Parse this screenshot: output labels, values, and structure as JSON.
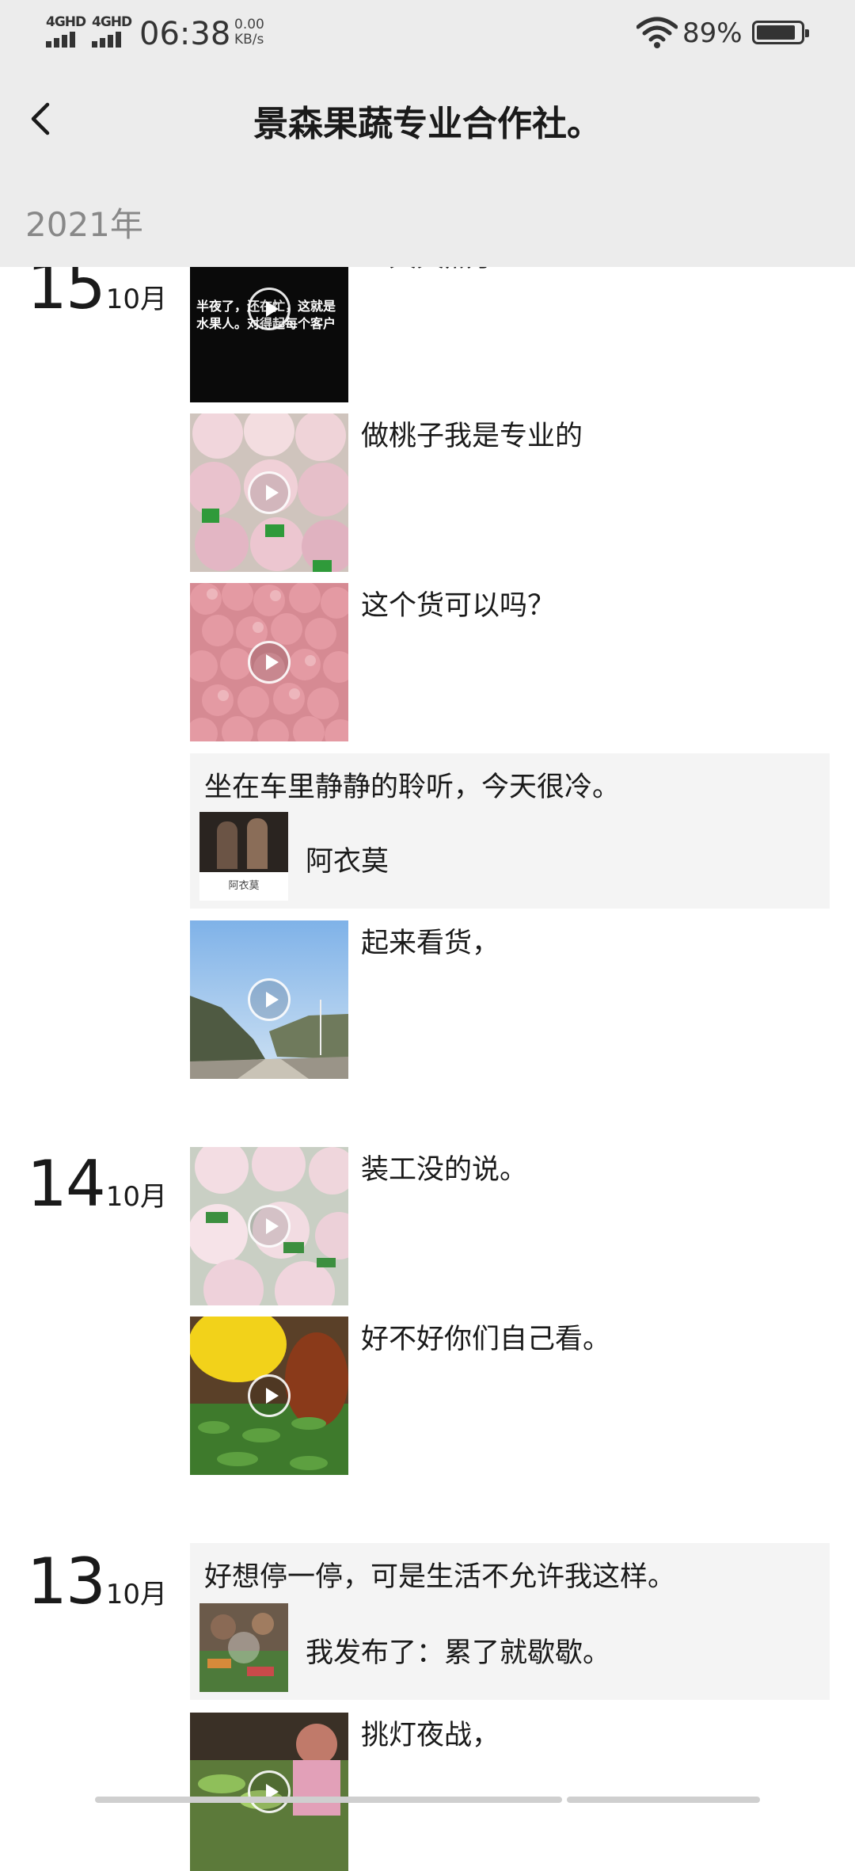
{
  "status_bar": {
    "network_1": "4GHD",
    "network_2": "4GHD",
    "time": "06:38",
    "speed_value": "0.00",
    "speed_unit": "KB/s",
    "battery_percent": "89%",
    "battery_level": 0.89
  },
  "header": {
    "title": "景森果蔬专业合作社。",
    "back_icon": "chevron-left-icon",
    "year": "2021年"
  },
  "days": [
    {
      "day": "15",
      "month": "10月",
      "posts": [
        {
          "type": "video",
          "caption": "…天天黑了",
          "overlay_text": "半夜了，还在忙，这就是水果人。对得起每个客户"
        },
        {
          "type": "video",
          "caption": "做桃子我是专业的"
        },
        {
          "type": "video",
          "caption": "这个货可以吗？"
        },
        {
          "type": "share",
          "text": "坐在车里静静的聆听，今天很冷。",
          "label": "阿衣莫",
          "thumb_text": "阿衣莫"
        },
        {
          "type": "video",
          "caption": "起来看货，"
        }
      ]
    },
    {
      "day": "14",
      "month": "10月",
      "posts": [
        {
          "type": "video",
          "caption": "装工没的说。"
        },
        {
          "type": "video",
          "caption": "好不好你们自己看。"
        }
      ]
    },
    {
      "day": "13",
      "month": "10月",
      "posts": [
        {
          "type": "share",
          "text": "好想停一停，可是生活不允许我这样。",
          "label": "我发布了：累了就歇歇。"
        },
        {
          "type": "video",
          "caption": "挑灯夜战，"
        }
      ]
    }
  ],
  "colors": {
    "header_bg": "#ececec",
    "share_bg": "#f4f4f4",
    "year_text": "#888888"
  }
}
